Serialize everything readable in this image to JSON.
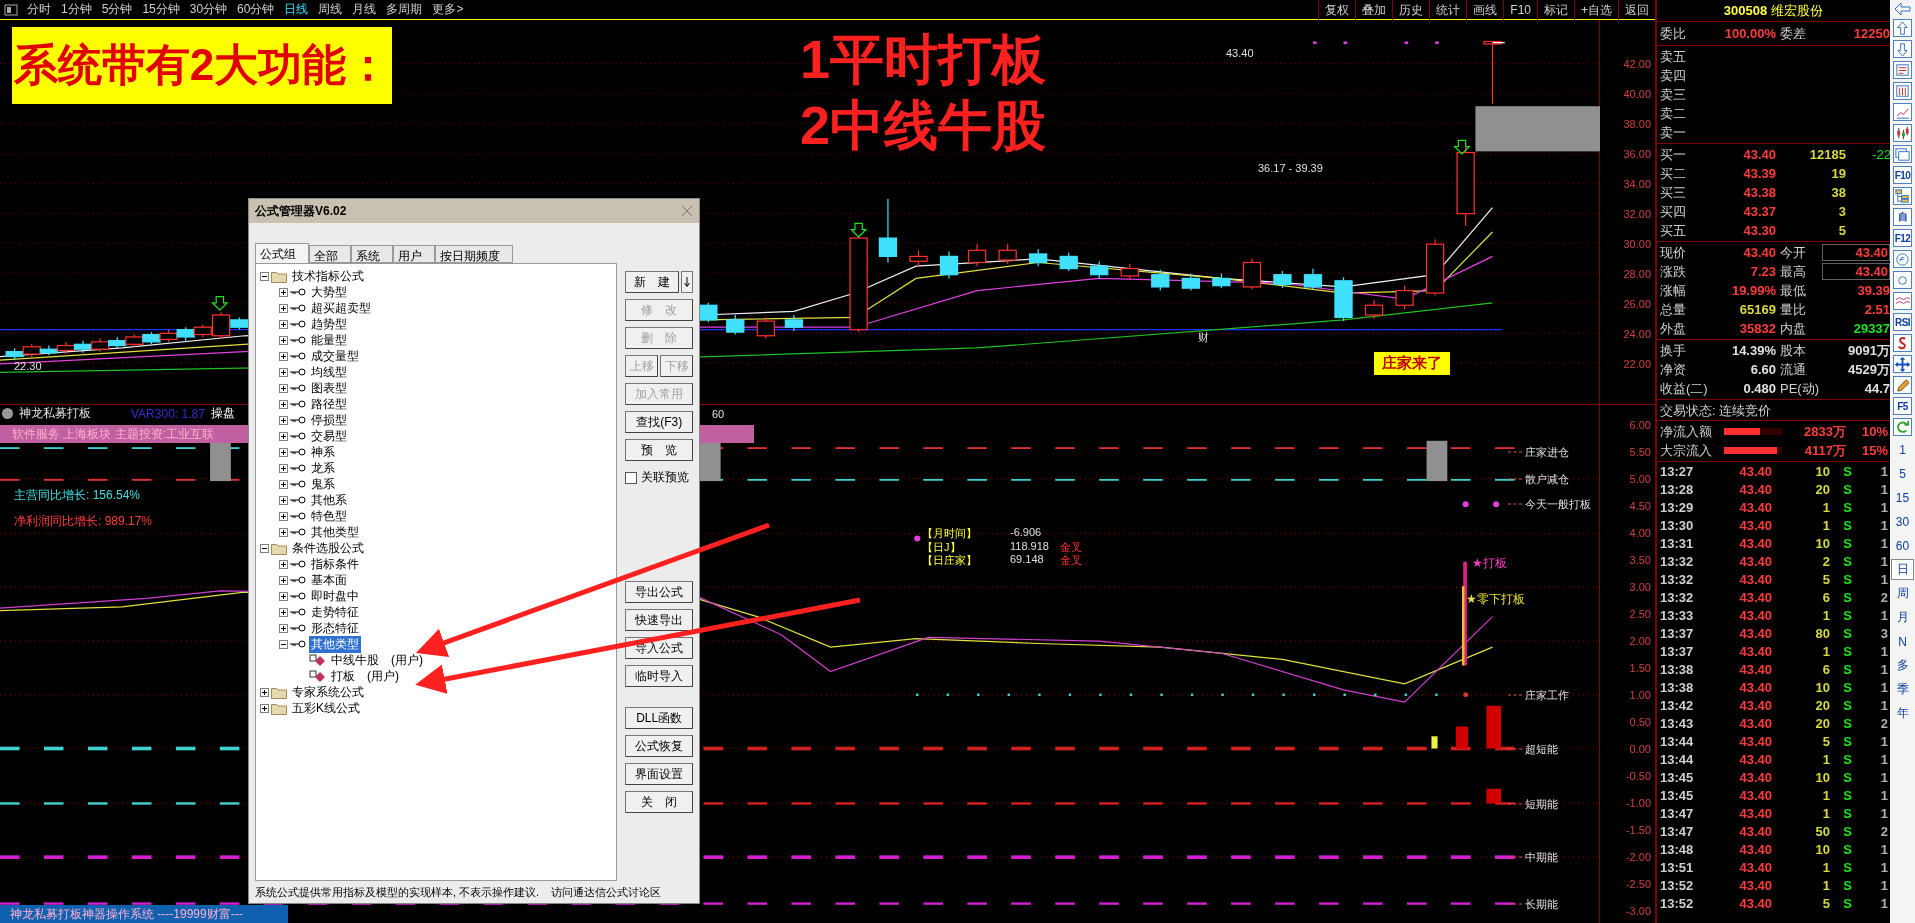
{
  "toolbar": {
    "periods": [
      {
        "label": "分时",
        "selected": false
      },
      {
        "label": "1分钟",
        "selected": false
      },
      {
        "label": "5分钟",
        "selected": false
      },
      {
        "label": "15分钟",
        "selected": false
      },
      {
        "label": "30分钟",
        "selected": false
      },
      {
        "label": "60分钟",
        "selected": false
      },
      {
        "label": "日线",
        "selected": true
      },
      {
        "label": "周线",
        "selected": false
      },
      {
        "label": "月线",
        "selected": false
      },
      {
        "label": "多周期",
        "selected": false
      },
      {
        "label": "更多>",
        "selected": false
      }
    ],
    "tools": [
      "复权",
      "叠加",
      "历史",
      "统计",
      "画线",
      "F10",
      "标记",
      "+自选",
      "返回"
    ]
  },
  "banner": {
    "text": "系统带有2大功能："
  },
  "headline": [
    "1平时打板",
    "2中线牛股"
  ],
  "price_chart": {
    "axis": [
      "42.00",
      "40.00",
      "38.00",
      "36.00",
      "34.00",
      "32.00",
      "30.00",
      "28.00",
      "26.00",
      "24.00",
      "22.00"
    ],
    "labels": [
      "43.40",
      "36.17 - 39.39",
      "22.30",
      "财"
    ],
    "tag": "庄家来了"
  },
  "indicator": {
    "title": "神龙私募打板",
    "var": "VAR300: 1.87",
    "mode": "操盘",
    "cut_value": "60",
    "sector": "软件服务 上海板块 主题投资:工业互联",
    "growth": [
      {
        "label": "主营同比增长: 156.54%",
        "color": "#40e0e0"
      },
      {
        "label": "净利润同比增长: 989.17%",
        "color": "#ff3c3c"
      }
    ],
    "legend": [
      {
        "name": "【月时间】",
        "value": "-6.906"
      },
      {
        "name": "【日J】",
        "value": "118.918",
        "signal": "金叉"
      },
      {
        "name": "【日庄家】",
        "value": "69.148",
        "signal": "金叉"
      }
    ],
    "axis": [
      "6.00",
      "5.50",
      "5.00",
      "4.50",
      "4.00",
      "3.50",
      "3.00",
      "2.50",
      "2.00",
      "1.50",
      "1.00",
      "0.50",
      "0.00",
      "-0.50",
      "-1.00",
      "-1.50",
      "-2.00",
      "-2.50",
      "-3.00"
    ],
    "signals": [
      "庄家进仓",
      "散户减仓",
      "今天一般打板",
      "庄家工作",
      "超短能",
      "短期能",
      "中期能",
      "长期能"
    ],
    "marks": [
      "★打板",
      "★零下打板"
    ]
  },
  "status_bar": {
    "text": "神龙私募打板神器操作系统 ----19999财富---"
  },
  "dialog": {
    "title": "公式管理器V6.02",
    "tabs": [
      {
        "label": "公式组",
        "selected": true
      },
      {
        "label": "全部",
        "selected": false
      },
      {
        "label": "系统",
        "selected": false
      },
      {
        "label": "用户",
        "selected": false
      },
      {
        "label": "按日期频度",
        "selected": false
      }
    ],
    "tree": [
      {
        "kind": "folder",
        "label": "技术指标公式",
        "expanded": true,
        "selected": false,
        "children": [
          {
            "kind": "group",
            "label": "大势型",
            "expanded": false,
            "selected": false
          },
          {
            "kind": "group",
            "label": "超买超卖型",
            "expanded": false,
            "selected": false
          },
          {
            "kind": "group",
            "label": "趋势型",
            "expanded": false,
            "selected": false
          },
          {
            "kind": "group",
            "label": "能量型",
            "expanded": false,
            "selected": false
          },
          {
            "kind": "group",
            "label": "成交量型",
            "expanded": false,
            "selected": false
          },
          {
            "kind": "group",
            "label": "均线型",
            "expanded": false,
            "selected": false
          },
          {
            "kind": "group",
            "label": "图表型",
            "expanded": false,
            "selected": false
          },
          {
            "kind": "group",
            "label": "路径型",
            "expanded": false,
            "selected": false
          },
          {
            "kind": "group",
            "label": "停损型",
            "expanded": false,
            "selected": false
          },
          {
            "kind": "group",
            "label": "交易型",
            "expanded": false,
            "selected": false
          },
          {
            "kind": "group",
            "label": "神系",
            "expanded": false,
            "selected": false
          },
          {
            "kind": "group",
            "label": "龙系",
            "expanded": false,
            "selected": false
          },
          {
            "kind": "group",
            "label": "鬼系",
            "expanded": false,
            "selected": false
          },
          {
            "kind": "group",
            "label": "其他系",
            "expanded": false,
            "selected": false
          },
          {
            "kind": "group",
            "label": "特色型",
            "expanded": false,
            "selected": false
          },
          {
            "kind": "group",
            "label": "其他类型",
            "expanded": false,
            "selected": false
          }
        ]
      },
      {
        "kind": "folder",
        "label": "条件选股公式",
        "expanded": true,
        "selected": false,
        "children": [
          {
            "kind": "group",
            "label": "指标条件",
            "expanded": false,
            "selected": false
          },
          {
            "kind": "group",
            "label": "基本面",
            "expanded": false,
            "selected": false
          },
          {
            "kind": "group",
            "label": "即时盘中",
            "expanded": false,
            "selected": false
          },
          {
            "kind": "group",
            "label": "走势特征",
            "expanded": false,
            "selected": false
          },
          {
            "kind": "group",
            "label": "形态特征",
            "expanded": false,
            "selected": false
          },
          {
            "kind": "group",
            "label": "其他类型",
            "expanded": true,
            "selected": true,
            "children": [
              {
                "kind": "formula",
                "label": "中线牛股　(用户)",
                "selected": false
              },
              {
                "kind": "formula",
                "label": "打板　(用户)",
                "selected": false
              }
            ]
          }
        ]
      },
      {
        "kind": "folder",
        "label": "专家系统公式",
        "expanded": false,
        "selected": false
      },
      {
        "kind": "folder",
        "label": "五彩K线公式",
        "expanded": false,
        "selected": false
      }
    ],
    "button_groups": [
      [
        {
          "kind": "split",
          "label": "新　建",
          "disabled": false
        },
        {
          "kind": "wide",
          "label": "修　改",
          "disabled": true
        },
        {
          "kind": "wide",
          "label": "删　除",
          "disabled": true
        },
        {
          "kind": "half",
          "label": "上移",
          "disabled": true
        },
        {
          "kind": "half",
          "label": "下移",
          "disabled": true
        },
        {
          "kind": "wide",
          "label": "加入常用",
          "disabled": true
        },
        {
          "kind": "wide",
          "label": "查找(F3)",
          "disabled": false
        },
        {
          "kind": "wide",
          "label": "预　览",
          "disabled": false
        }
      ],
      [
        {
          "kind": "wide",
          "label": "导出公式",
          "disabled": false
        },
        {
          "kind": "wide",
          "label": "快速导出",
          "disabled": false
        },
        {
          "kind": "wide",
          "label": "导入公式",
          "disabled": false
        },
        {
          "kind": "wide",
          "label": "临时导入",
          "disabled": false
        }
      ],
      [
        {
          "kind": "wide",
          "label": "DLL函数",
          "disabled": false
        },
        {
          "kind": "wide",
          "label": "公式恢复",
          "disabled": false
        },
        {
          "kind": "wide",
          "label": "界面设置",
          "disabled": false
        },
        {
          "kind": "wide",
          "label": "关　闭",
          "disabled": false
        }
      ]
    ],
    "preview_checkbox": {
      "label": "关联预览",
      "checked": false
    },
    "note": "系统公式提供常用指标及模型的实现样本, 不表示操作建议.",
    "link": "访问通达信公式讨论区"
  },
  "quote": {
    "title_code": "300508",
    "title_name": "维宏股份",
    "ratio": {
      "label": "委比",
      "value": "100.00%",
      "label2": "委差",
      "value2": "12250"
    },
    "asks": [
      "卖五",
      "卖四",
      "卖三",
      "卖二",
      "卖一"
    ],
    "bids": [
      {
        "label": "买一",
        "price": "43.40",
        "volume": "12185",
        "change": "-22"
      },
      {
        "label": "买二",
        "price": "43.39",
        "volume": "19"
      },
      {
        "label": "买三",
        "price": "43.38",
        "volume": "38"
      },
      {
        "label": "买四",
        "price": "43.37",
        "volume": "3"
      },
      {
        "label": "买五",
        "price": "43.30",
        "volume": "5"
      }
    ],
    "stats": [
      {
        "left": {
          "label": "现价",
          "value": "43.40",
          "color": "#ff3c3c"
        },
        "right": {
          "label": "今开",
          "value": "43.40",
          "color": "#ff3c3c",
          "boxed": true
        }
      },
      {
        "left": {
          "label": "涨跌",
          "value": "7.23",
          "color": "#ff3c3c"
        },
        "right": {
          "label": "最高",
          "value": "43.40",
          "color": "#ff3c3c",
          "boxed": true
        }
      },
      {
        "left": {
          "label": "涨幅",
          "value": "19.99%",
          "color": "#ff3c3c"
        },
        "right": {
          "label": "最低",
          "value": "39.39",
          "color": "#ff3c3c",
          "boxed": false
        }
      },
      {
        "left": {
          "label": "总量",
          "value": "65169",
          "color": "#d8d840"
        },
        "right": {
          "label": "量比",
          "value": "2.51",
          "color": "#ff3c3c",
          "boxed": false
        }
      },
      {
        "left": {
          "label": "外盘",
          "value": "35832",
          "color": "#ff3c3c"
        },
        "right": {
          "label": "内盘",
          "value": "29337",
          "color": "#20e020",
          "boxed": false
        }
      }
    ],
    "fundamentals": [
      {
        "label": "换手",
        "value": "14.39%",
        "label2": "股本",
        "value2": "9091万"
      },
      {
        "label": "净资",
        "value": "6.60",
        "label2": "流通",
        "value2": "4529万"
      },
      {
        "label": "收益(二)",
        "value": "0.480",
        "label2": "PE(动)",
        "value2": "44.7"
      }
    ],
    "trade_status": "交易状态: 连续竞价",
    "flows": [
      {
        "label": "净流入额",
        "level": 0.62,
        "amount": "2833万",
        "pct": "10%"
      },
      {
        "label": "大宗流入",
        "level": 0.92,
        "amount": "4117万",
        "pct": "15%"
      }
    ],
    "trades": [
      {
        "time": "13:27",
        "price": "43.40",
        "volume": "10",
        "side": "S",
        "count": "1"
      },
      {
        "time": "13:28",
        "price": "43.40",
        "volume": "20",
        "side": "S",
        "count": "1"
      },
      {
        "time": "13:29",
        "price": "43.40",
        "volume": "1",
        "side": "S",
        "count": "1"
      },
      {
        "time": "13:30",
        "price": "43.40",
        "volume": "1",
        "side": "S",
        "count": "1"
      },
      {
        "time": "13:31",
        "price": "43.40",
        "volume": "10",
        "side": "S",
        "count": "1"
      },
      {
        "time": "13:32",
        "price": "43.40",
        "volume": "2",
        "side": "S",
        "count": "1"
      },
      {
        "time": "13:32",
        "price": "43.40",
        "volume": "5",
        "side": "S",
        "count": "1"
      },
      {
        "time": "13:32",
        "price": "43.40",
        "volume": "6",
        "side": "S",
        "count": "2"
      },
      {
        "time": "13:33",
        "price": "43.40",
        "volume": "1",
        "side": "S",
        "count": "1"
      },
      {
        "time": "13:37",
        "price": "43.40",
        "volume": "80",
        "side": "S",
        "count": "3"
      },
      {
        "time": "13:37",
        "price": "43.40",
        "volume": "1",
        "side": "S",
        "count": "1"
      },
      {
        "time": "13:38",
        "price": "43.40",
        "volume": "6",
        "side": "S",
        "count": "1"
      },
      {
        "time": "13:38",
        "price": "43.40",
        "volume": "10",
        "side": "S",
        "count": "1"
      },
      {
        "time": "13:42",
        "price": "43.40",
        "volume": "20",
        "side": "S",
        "count": "1"
      },
      {
        "time": "13:43",
        "price": "43.40",
        "volume": "20",
        "side": "S",
        "count": "2"
      },
      {
        "time": "13:44",
        "price": "43.40",
        "volume": "5",
        "side": "S",
        "count": "1"
      },
      {
        "time": "13:44",
        "price": "43.40",
        "volume": "1",
        "side": "S",
        "count": "1"
      },
      {
        "time": "13:45",
        "price": "43.40",
        "volume": "10",
        "side": "S",
        "count": "1"
      },
      {
        "time": "13:45",
        "price": "43.40",
        "volume": "1",
        "side": "S",
        "count": "1"
      },
      {
        "time": "13:47",
        "price": "43.40",
        "volume": "1",
        "side": "S",
        "count": "1"
      },
      {
        "time": "13:47",
        "price": "43.40",
        "volume": "50",
        "side": "S",
        "count": "2"
      },
      {
        "time": "13:48",
        "price": "43.40",
        "volume": "10",
        "side": "S",
        "count": "1"
      },
      {
        "time": "13:51",
        "price": "43.40",
        "volume": "1",
        "side": "S",
        "count": "1"
      },
      {
        "time": "13:52",
        "price": "43.40",
        "volume": "1",
        "side": "S",
        "count": "1"
      },
      {
        "time": "13:52",
        "price": "43.40",
        "volume": "5",
        "side": "S",
        "count": "1"
      }
    ]
  },
  "side_tools": [
    {
      "kind": "icon"
    },
    {
      "kind": "icon"
    },
    {
      "kind": "icon"
    },
    {
      "kind": "icon"
    },
    {
      "kind": "icon"
    },
    {
      "kind": "icon"
    },
    {
      "kind": "icon"
    },
    {
      "kind": "text",
      "label": "F10"
    },
    {
      "kind": "icon"
    },
    {
      "kind": "text",
      "label": "自"
    },
    {
      "kind": "text",
      "label": "F12"
    },
    {
      "kind": "icon"
    },
    {
      "kind": "icon"
    },
    {
      "kind": "icon"
    },
    {
      "kind": "text",
      "label": "RSI"
    },
    {
      "kind": "icon"
    },
    {
      "kind": "icon"
    },
    {
      "kind": "icon"
    },
    {
      "kind": "text",
      "label": "F5"
    },
    {
      "kind": "icon"
    }
  ],
  "side_periods": [
    {
      "label": "1",
      "selected": false
    },
    {
      "label": "5",
      "selected": false
    },
    {
      "label": "15",
      "selected": false
    },
    {
      "label": "30",
      "selected": false
    },
    {
      "label": "60",
      "selected": false
    },
    {
      "label": "日",
      "selected": true
    },
    {
      "label": "周",
      "selected": false
    },
    {
      "label": "月",
      "selected": false
    },
    {
      "label": "N",
      "selected": false
    },
    {
      "label": "多",
      "selected": false
    },
    {
      "label": "季",
      "selected": false
    },
    {
      "label": "年",
      "selected": false
    }
  ]
}
